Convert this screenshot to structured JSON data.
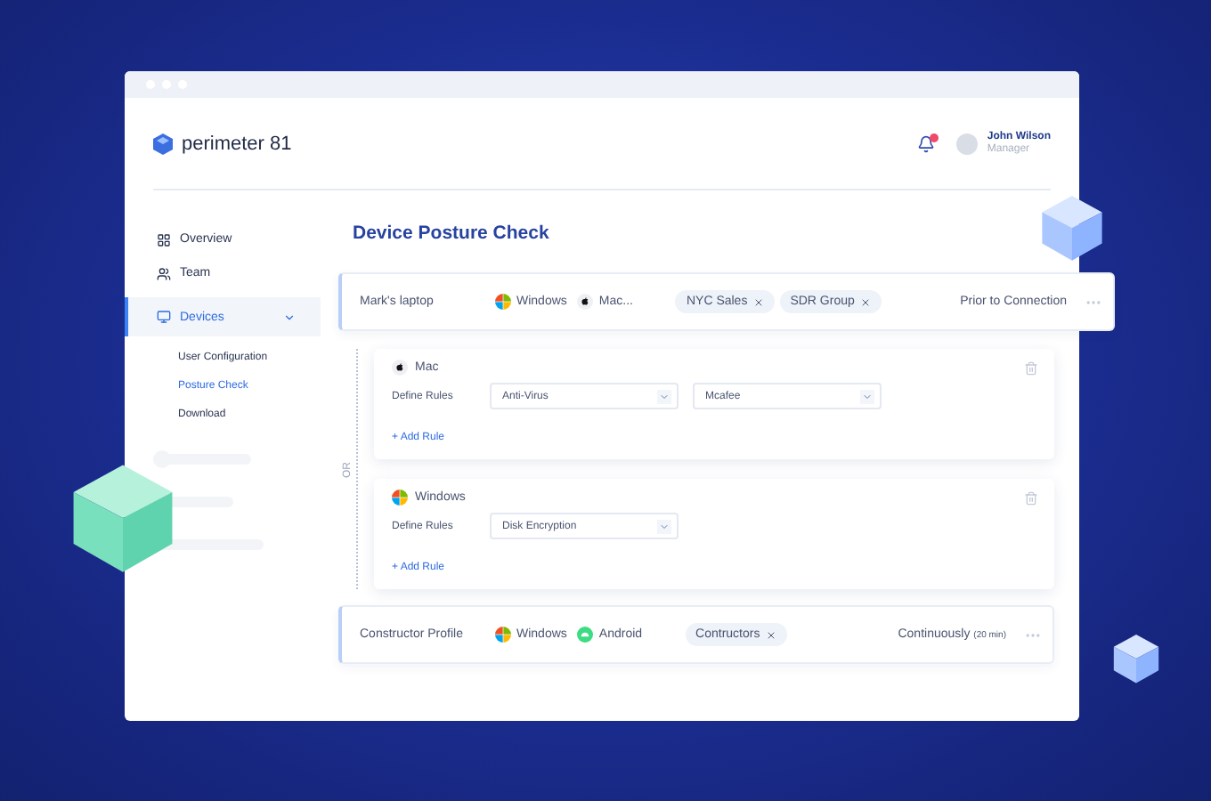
{
  "brand": {
    "name": "perimeter 81"
  },
  "header": {
    "notification_badge": true,
    "user": {
      "name": "John Wilson",
      "role": "Manager"
    }
  },
  "sidebar": {
    "items": [
      {
        "label": "Overview",
        "kind": "grid",
        "selected": false
      },
      {
        "label": "Team",
        "kind": "people",
        "selected": false
      },
      {
        "label": "Devices",
        "kind": "monitor",
        "selected": true,
        "expanded": true,
        "children": [
          {
            "label": "User Configuration",
            "selected": false
          },
          {
            "label": "Posture Check",
            "selected": true
          },
          {
            "label": "Download",
            "selected": false
          }
        ]
      }
    ]
  },
  "page_title": "Device Posture Check",
  "or_label": "OR",
  "profiles": [
    {
      "name": "Mark's laptop",
      "platforms": [
        {
          "kind": "windows",
          "label": "Windows"
        },
        {
          "kind": "mac",
          "label": "Mac..."
        }
      ],
      "tags": [
        "NYC Sales",
        "SDR Group"
      ],
      "trigger": "Prior to Connection",
      "rule_groups": [
        {
          "kind": "mac",
          "label": "Mac",
          "rules_label": "Define Rules",
          "selects": [
            "Anti-Virus",
            "Mcafee"
          ],
          "add_rule": "+ Add Rule"
        },
        {
          "kind": "windows",
          "label": "Windows",
          "rules_label": "Define Rules",
          "selects": [
            "Disk Encryption"
          ],
          "add_rule": "+ Add Rule"
        }
      ]
    },
    {
      "name": "Constructor Profile",
      "platforms": [
        {
          "kind": "windows",
          "label": "Windows"
        },
        {
          "kind": "android",
          "label": "Android"
        }
      ],
      "tags": [
        "Contructors"
      ],
      "trigger": "Continuously",
      "trigger_note": "(20 min)"
    }
  ]
}
